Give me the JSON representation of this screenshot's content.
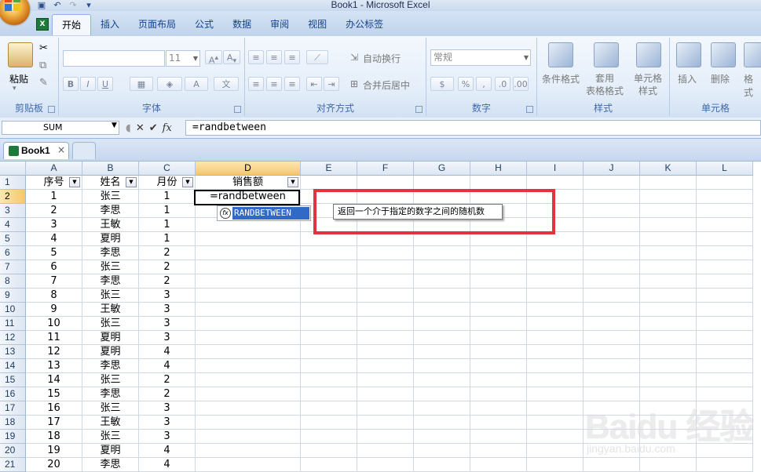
{
  "window": {
    "title": "Book1 - Microsoft Excel"
  },
  "ribbon": {
    "tabs": [
      "开始",
      "插入",
      "页面布局",
      "公式",
      "数据",
      "审阅",
      "视图",
      "办公标签"
    ],
    "active_tab": "开始",
    "clipboard": {
      "paste_label": "粘贴",
      "group_label": "剪贴板"
    },
    "font": {
      "font_name": "",
      "font_size": "11",
      "group_label": "字体"
    },
    "alignment": {
      "wrap_label": "自动换行",
      "merge_label": "合并后居中",
      "group_label": "对齐方式"
    },
    "number": {
      "format_value": "常规",
      "group_label": "数字"
    },
    "styles": {
      "conditional_label": "条件格式",
      "table_format_label": "套用\n表格格式",
      "cell_style_label": "单元格\n样式",
      "group_label": "样式"
    },
    "cells": {
      "insert_label": "插入",
      "delete_label": "删除",
      "format_label": "格式",
      "group_label": "单元格"
    }
  },
  "formula_bar": {
    "name_box": "SUM",
    "formula": "=randbetween"
  },
  "workbook_tab": {
    "label": "Book1",
    "close": "×"
  },
  "sheet": {
    "columns": [
      "A",
      "B",
      "C",
      "D",
      "E",
      "F",
      "G",
      "H",
      "I",
      "J",
      "K",
      "L"
    ],
    "selected_column": "D",
    "selected_row": "2",
    "header_row": [
      "序号",
      "姓名",
      "月份",
      "销售额"
    ],
    "rows": [
      [
        "1",
        "张三",
        "1"
      ],
      [
        "2",
        "李思",
        "1"
      ],
      [
        "3",
        "王敏",
        "1"
      ],
      [
        "4",
        "夏明",
        "1"
      ],
      [
        "5",
        "李思",
        "2"
      ],
      [
        "6",
        "张三",
        "2"
      ],
      [
        "7",
        "李思",
        "2"
      ],
      [
        "8",
        "张三",
        "3"
      ],
      [
        "9",
        "王敏",
        "3"
      ],
      [
        "10",
        "张三",
        "3"
      ],
      [
        "11",
        "夏明",
        "3"
      ],
      [
        "12",
        "夏明",
        "4"
      ],
      [
        "13",
        "李思",
        "4"
      ],
      [
        "14",
        "张三",
        "2"
      ],
      [
        "15",
        "李思",
        "2"
      ],
      [
        "16",
        "张三",
        "3"
      ],
      [
        "17",
        "王敏",
        "3"
      ],
      [
        "18",
        "张三",
        "3"
      ],
      [
        "19",
        "夏明",
        "4"
      ],
      [
        "20",
        "李思",
        "4"
      ]
    ],
    "row_numbers": [
      "1",
      "2",
      "3",
      "4",
      "5",
      "6",
      "7",
      "8",
      "9",
      "10",
      "11",
      "12",
      "13",
      "14",
      "15",
      "16",
      "17",
      "18",
      "19",
      "20",
      "21"
    ],
    "active_cell_value": "=randbetween"
  },
  "autocomplete": {
    "function": "RANDBETWEEN"
  },
  "tooltip": {
    "text": "返回一个介于指定的数字之间的随机数"
  },
  "watermark": {
    "text": "Baidu 经验",
    "sub": "jingyan.baidu.com"
  }
}
